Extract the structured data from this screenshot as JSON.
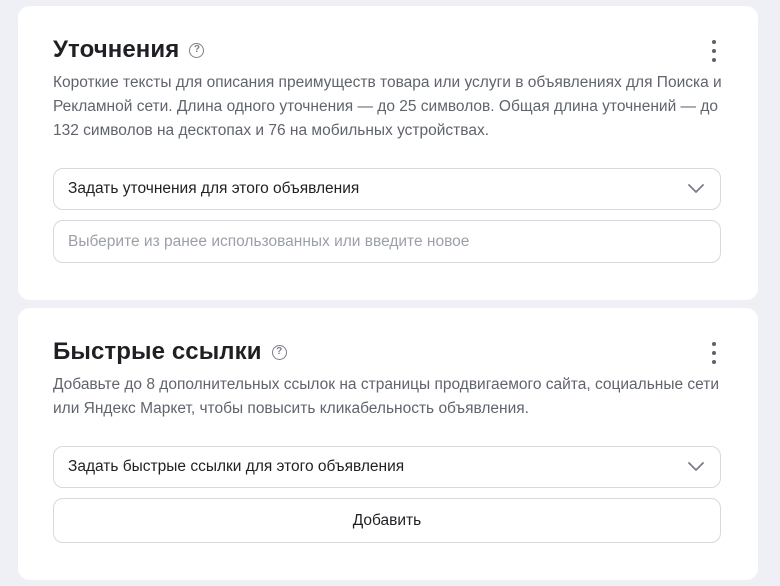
{
  "refinements": {
    "title": "Уточнения",
    "help_symbol": "?",
    "description": "Короткие тексты для описания преимуществ товара или услуги в объявлениях для Поиска и Рекламной сети. Длина одного уточнения — до 25 символов. Общая длина уточнений — до 132 символов на десктопах и 76 на мобильных устройствах.",
    "select_label": "Задать уточнения для этого объявления",
    "input_placeholder": "Выберите из ранее использованных или введите новое",
    "input_value": ""
  },
  "quick_links": {
    "title": "Быстрые ссылки",
    "help_symbol": "?",
    "description": "Добавьте до 8 дополнительных ссылок на страницы продвигаемого сайта, социальные сети или Яндекс Маркет, чтобы повысить кликабельность объявления.",
    "select_label": "Задать быстрые ссылки для этого объявления",
    "add_button_label": "Добавить"
  },
  "icons": {
    "help": "help-circle-icon",
    "more": "more-vertical-icon",
    "chevron": "chevron-down-icon"
  },
  "colors": {
    "page_background": "#eef0f5",
    "card_background": "#ffffff",
    "text_primary": "#1f2024",
    "text_secondary": "#5f646d",
    "border": "#d6d9df"
  }
}
